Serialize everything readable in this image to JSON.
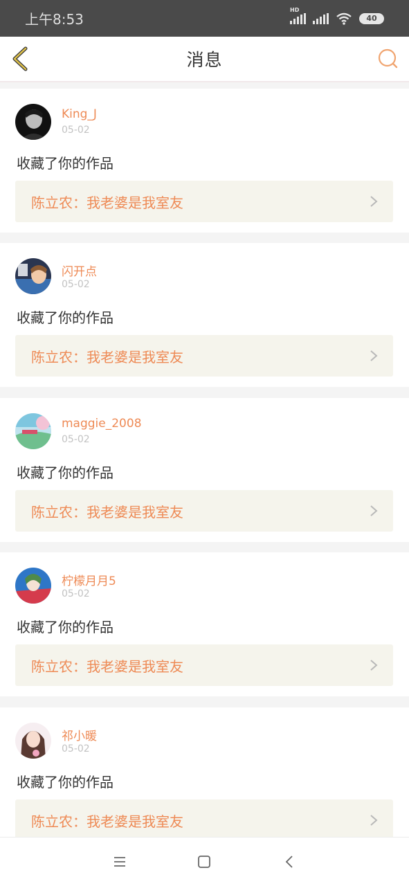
{
  "status_bar": {
    "time": "上午8:53",
    "battery": "40"
  },
  "header": {
    "title": "消息"
  },
  "messages": [
    {
      "user": "King_J",
      "date": "05-02",
      "action": "收藏了你的作品",
      "work": "陈立农：我老婆是我室友"
    },
    {
      "user": "闪开点",
      "date": "05-02",
      "action": "收藏了你的作品",
      "work": "陈立农：我老婆是我室友"
    },
    {
      "user": "maggie_2008",
      "date": "05-02",
      "action": "收藏了你的作品",
      "work": "陈立农：我老婆是我室友"
    },
    {
      "user": "柠檬月月5",
      "date": "05-02",
      "action": "收藏了你的作品",
      "work": "陈立农：我老婆是我室友"
    },
    {
      "user": "祁小暖",
      "date": "05-02",
      "action": "收藏了你的作品",
      "work": "陈立农：我老婆是我室友"
    }
  ],
  "icons": {
    "back": "chevron-left-icon",
    "search": "search-icon",
    "work_arrow": "chevron-right-icon",
    "home": "home-square-icon",
    "menu": "menu-icon",
    "system_back": "back-icon"
  },
  "colors": {
    "accent": "#ee8a55",
    "back_icon": "#c9a83a",
    "work_bg": "#f5f4ec"
  }
}
